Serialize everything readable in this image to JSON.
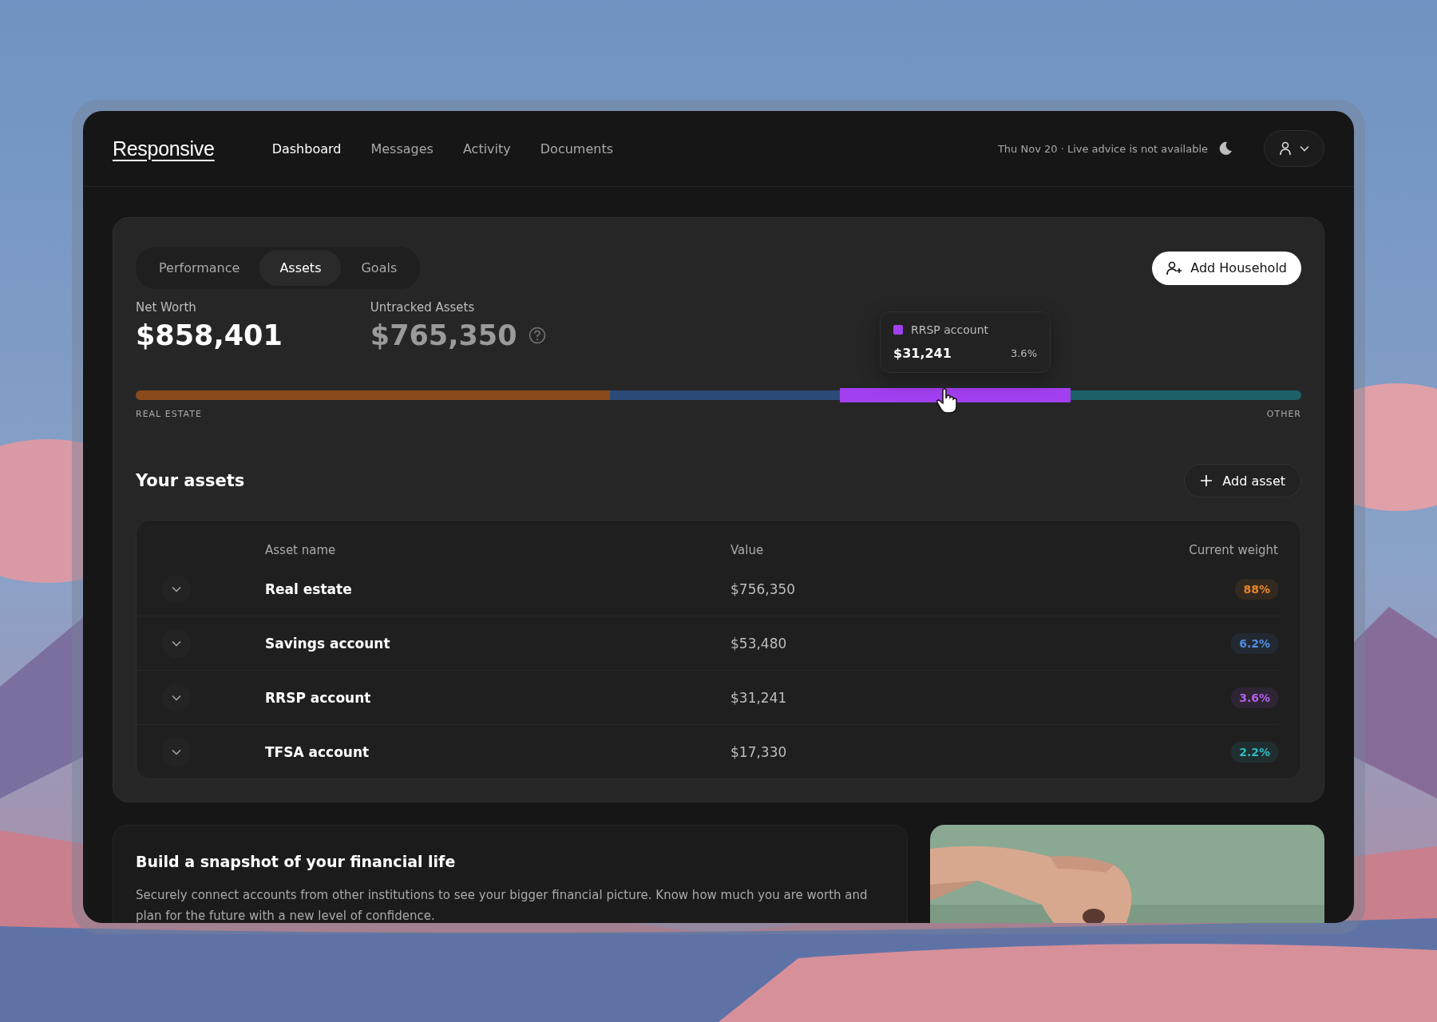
{
  "header": {
    "logo": "Responsive",
    "nav": [
      {
        "label": "Dashboard",
        "selected": true
      },
      {
        "label": "Messages",
        "selected": false
      },
      {
        "label": "Activity",
        "selected": false
      },
      {
        "label": "Documents",
        "selected": false
      }
    ],
    "status": "Thu Nov 20 · Live advice is not available"
  },
  "overview": {
    "tabs": [
      {
        "label": "Performance",
        "selected": false
      },
      {
        "label": "Assets",
        "selected": true
      },
      {
        "label": "Goals",
        "selected": false
      }
    ],
    "add_household": "Add Household",
    "net_worth": {
      "label": "Net Worth",
      "value": "$858,401"
    },
    "untracked": {
      "label": "Untracked Assets",
      "value": "$765,350"
    },
    "allocation": {
      "segments": [
        {
          "color": "#8a4a1c",
          "selected": false
        },
        {
          "color": "#2c4a78",
          "selected": false
        },
        {
          "color": "#a23ff0",
          "selected": true
        },
        {
          "color": "#1d6068",
          "selected": false
        }
      ],
      "start_label": "REAL ESTATE",
      "end_label": "OTHER"
    },
    "tooltip": {
      "name": "RRSP account",
      "color": "#a23ff0",
      "value": "$31,241",
      "weight": "3.6%"
    }
  },
  "assets": {
    "title": "Your assets",
    "add_button": "Add asset",
    "columns": [
      "Asset name",
      "Value",
      "Current weight"
    ],
    "rows": [
      {
        "name": "Real estate",
        "value": "$756,350",
        "weight": "88%",
        "color": "#e8862a"
      },
      {
        "name": "Savings account",
        "value": "$53,480",
        "weight": "6.2%",
        "color": "#4f8de0"
      },
      {
        "name": "RRSP account",
        "value": "$31,241",
        "weight": "3.6%",
        "color": "#b45fe8"
      },
      {
        "name": "TFSA account",
        "value": "$17,330",
        "weight": "2.2%",
        "color": "#2fb7c4"
      }
    ]
  },
  "snapshot": {
    "title": "Build a snapshot of your financial life",
    "text": "Securely connect accounts from other institutions to see your bigger financial picture. Know how much you are worth and plan for the future with a new level of confidence."
  }
}
